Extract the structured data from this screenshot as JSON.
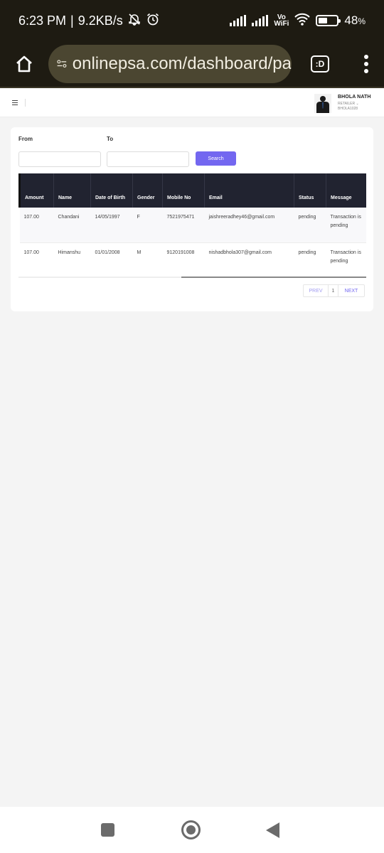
{
  "status_bar": {
    "time": "6:23 PM",
    "speed": "9.2KB/s",
    "vo_label": "Vo",
    "wifi_label": "WiFi",
    "battery_text": "48",
    "battery_unit": "%",
    "battery_level": 0.48
  },
  "browser": {
    "url": "onlinepsa.com/dashboard/pa",
    "tab_label": ":D"
  },
  "header": {
    "user_name": "BHOLA NATH",
    "user_role": "RETAILER ⌄",
    "user_id": "BHOLA1028"
  },
  "filters": {
    "from_label": "From",
    "to_label": "To",
    "from_value": "",
    "to_value": "",
    "search_label": "Search"
  },
  "table": {
    "columns": [
      "Amount",
      "Name",
      "Date of Birth",
      "Gender",
      "Mobile No",
      "Email",
      "Status",
      "Message"
    ],
    "rows": [
      [
        "107.00",
        "Chandani",
        "14/05/1997",
        "F",
        "7521975471",
        "jaishreeradhey46@gmail.com",
        "pending",
        "Transaction is pending"
      ],
      [
        "107.00",
        "Himanshu",
        "01/01/2008",
        "M",
        "9120191008",
        "nishadbhola307@gmail.com",
        "pending",
        "Transaction is pending"
      ]
    ]
  },
  "pagination": {
    "prev": "PREV",
    "page": "1",
    "next": "NEXT"
  },
  "colors": {
    "accent": "#7367f0",
    "table_header": "#212330",
    "browser_bg": "#1e1b12"
  }
}
